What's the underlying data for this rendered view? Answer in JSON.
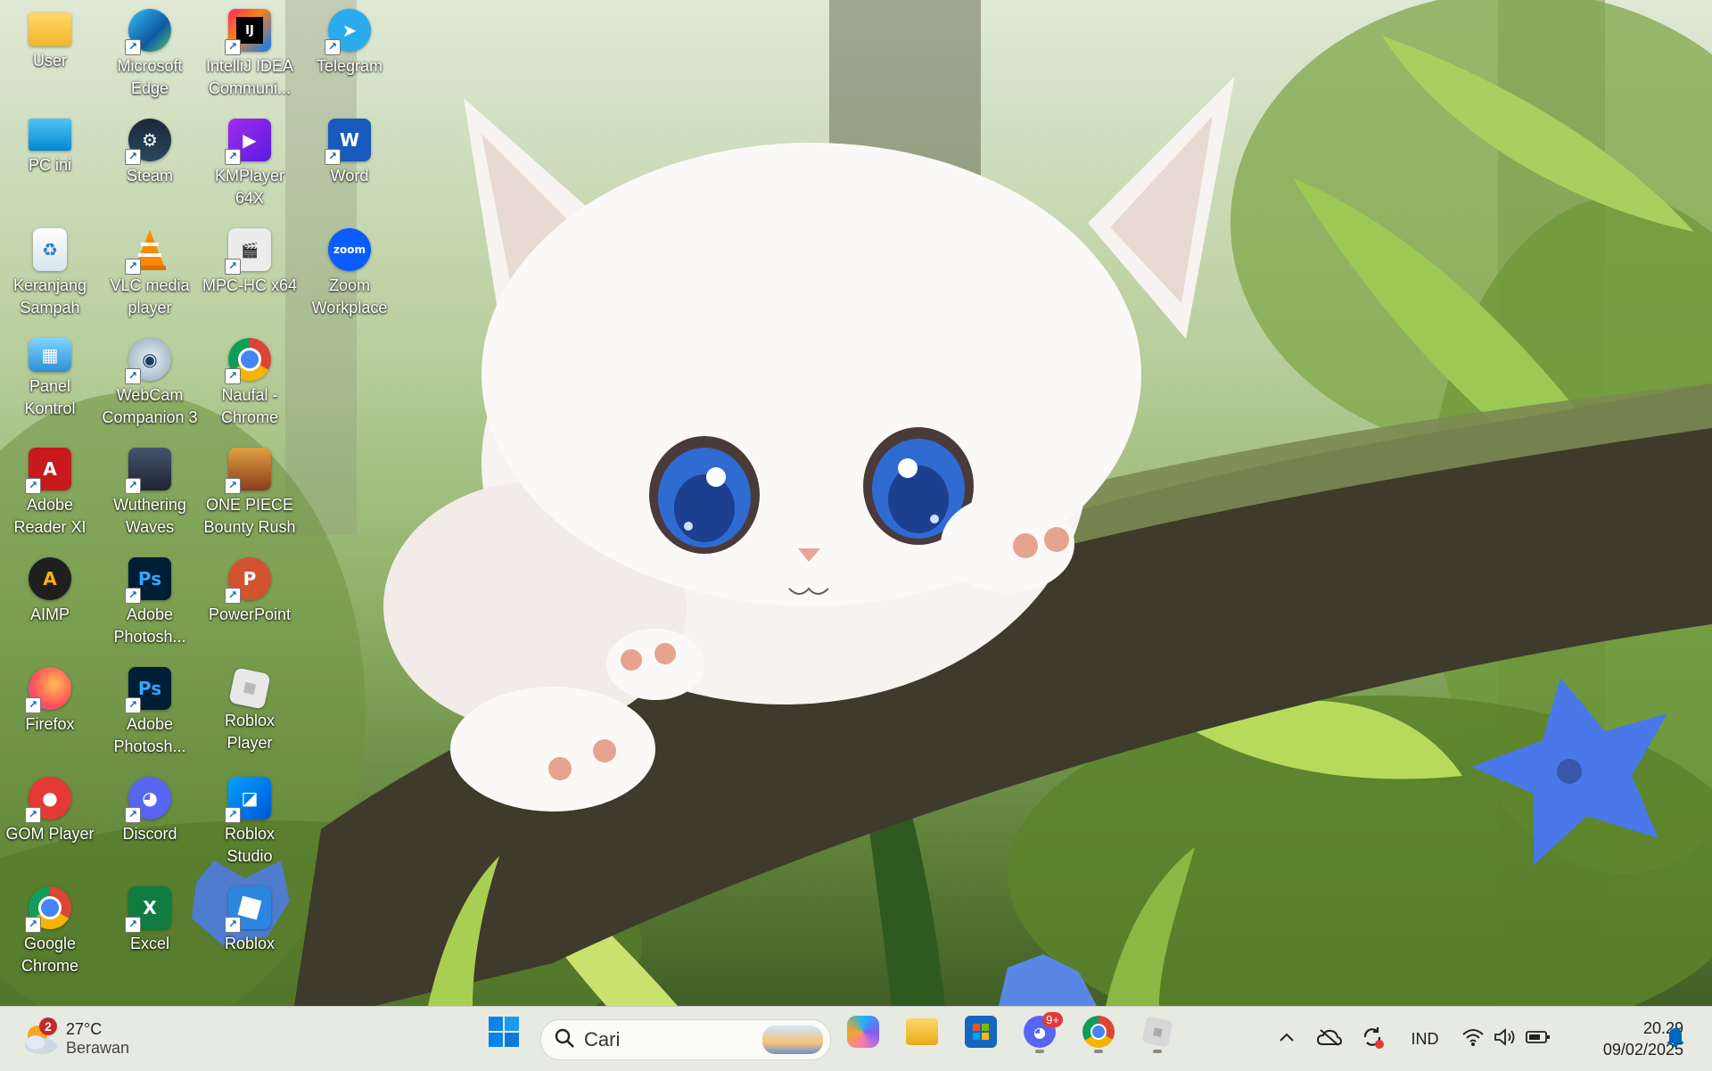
{
  "desktop": {
    "icons": [
      {
        "label": "User",
        "icon": "folder-icon"
      },
      {
        "label": "Microsoft Edge",
        "icon": "edge-icon"
      },
      {
        "label": "IntelliJ IDEA Communi...",
        "icon": "intellij-icon"
      },
      {
        "label": "Telegram",
        "icon": "telegram-icon"
      },
      {
        "label": "PC ini",
        "icon": "monitor-icon"
      },
      {
        "label": "Steam",
        "icon": "steam-icon"
      },
      {
        "label": "KMPlayer 64X",
        "icon": "kmplayer-icon"
      },
      {
        "label": "Word",
        "icon": "word-icon"
      },
      {
        "label": "Keranjang Sampah",
        "icon": "recycle-bin-icon"
      },
      {
        "label": "VLC media player",
        "icon": "vlc-icon"
      },
      {
        "label": "MPC-HC x64",
        "icon": "mpc-hc-icon"
      },
      {
        "label": "Zoom Workplace",
        "icon": "zoom-icon"
      },
      {
        "label": "Panel Kontrol",
        "icon": "control-panel-icon"
      },
      {
        "label": "WebCam Companion 3",
        "icon": "webcam-icon"
      },
      {
        "label": "Naufal - Chrome",
        "icon": "chrome-profile-icon"
      },
      {
        "label": "Adobe Reader XI",
        "icon": "adobe-reader-icon"
      },
      {
        "label": "Wuthering Waves",
        "icon": "wuthering-waves-icon"
      },
      {
        "label": "ONE PIECE Bounty Rush",
        "icon": "one-piece-icon"
      },
      {
        "label": "AIMP",
        "icon": "aimp-icon"
      },
      {
        "label": "Adobe Photosh...",
        "icon": "photoshop-icon"
      },
      {
        "label": "PowerPoint",
        "icon": "powerpoint-icon"
      },
      {
        "label": "Firefox",
        "icon": "firefox-icon"
      },
      {
        "label": "Adobe Photosh...",
        "icon": "photoshop-icon"
      },
      {
        "label": "Roblox Player",
        "icon": "roblox-player-icon"
      },
      {
        "label": "GOM Player",
        "icon": "gom-player-icon"
      },
      {
        "label": "Discord",
        "icon": "discord-icon"
      },
      {
        "label": "Roblox Studio",
        "icon": "roblox-studio-icon"
      },
      {
        "label": "Google Chrome",
        "icon": "chrome-icon"
      },
      {
        "label": "Excel",
        "icon": "excel-icon"
      },
      {
        "label": "Roblox",
        "icon": "roblox-icon"
      }
    ]
  },
  "taskbar": {
    "weather": {
      "temperature": "27°C",
      "condition": "Berawan",
      "badge": "2"
    },
    "search": {
      "placeholder": "Cari"
    },
    "pinned": [
      {
        "name": "start-button",
        "icon": "windows-start-icon"
      },
      {
        "name": "copilot-button",
        "icon": "copilot-icon"
      },
      {
        "name": "file-explorer-button",
        "icon": "folder-icon"
      },
      {
        "name": "microsoft-store-button",
        "icon": "store-icon"
      },
      {
        "name": "discord-taskbar-button",
        "icon": "discord-icon",
        "badge": "9+"
      },
      {
        "name": "chrome-taskbar-button",
        "icon": "chrome-icon"
      },
      {
        "name": "roblox-taskbar-button",
        "icon": "roblox-icon"
      }
    ],
    "tray": {
      "language": "IND",
      "time": "20.29",
      "date": "09/02/2025"
    }
  },
  "colors": {
    "taskbar_bg": "#e6e9e0",
    "accent": "#0067c0"
  }
}
